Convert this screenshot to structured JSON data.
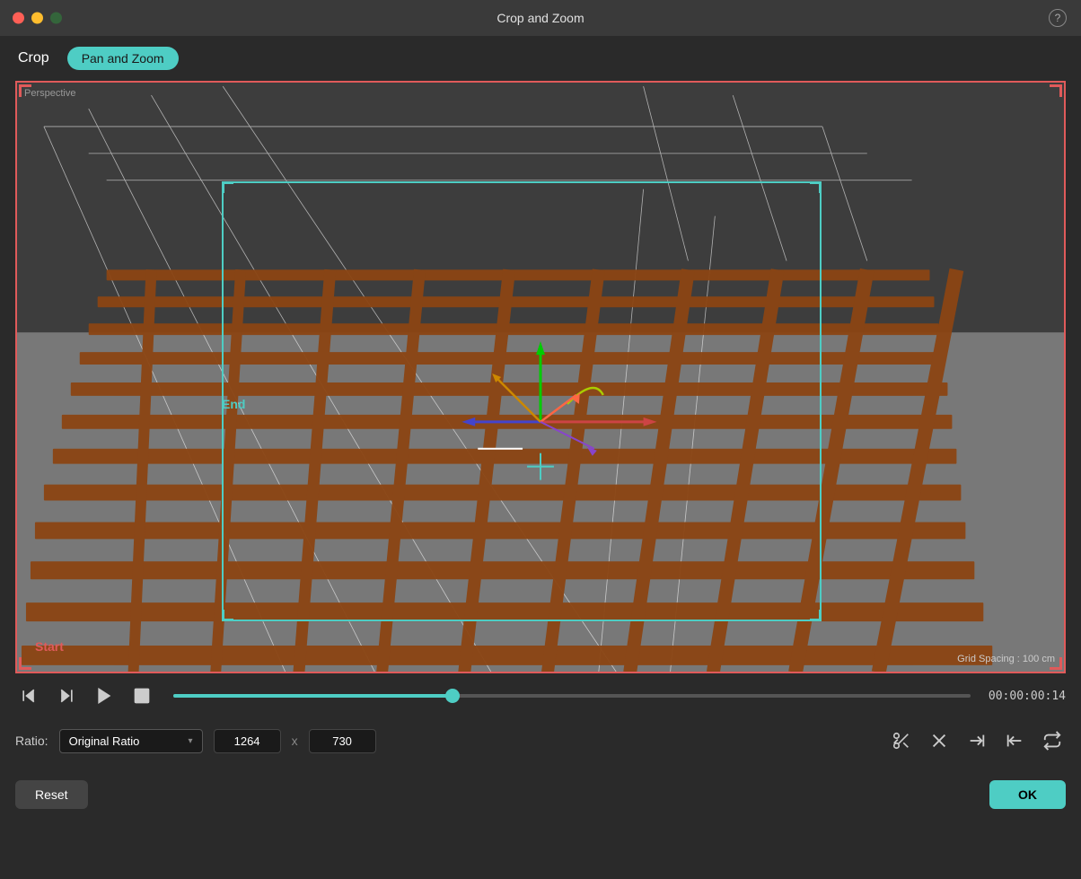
{
  "window": {
    "title": "Crop and Zoom",
    "help_label": "?"
  },
  "tabs": {
    "crop_label": "Crop",
    "pan_zoom_label": "Pan and Zoom"
  },
  "viewport": {
    "perspective_label": "Perspective",
    "grid_spacing_label": "Grid Spacing : 100 cm",
    "start_label": "Start",
    "end_label": "End"
  },
  "playback": {
    "time": "00:00:00:14",
    "progress_percent": 35
  },
  "ratio": {
    "label": "Ratio:",
    "selected": "Original Ratio",
    "width": "1264",
    "height": "730",
    "x_separator": "x"
  },
  "actions": {
    "reset_label": "Reset",
    "ok_label": "OK"
  },
  "colors": {
    "accent_cyan": "#4ecdc4",
    "accent_red": "#e05a5a",
    "bg_dark": "#2a2a2a",
    "bg_darker": "#1a1a1a"
  }
}
